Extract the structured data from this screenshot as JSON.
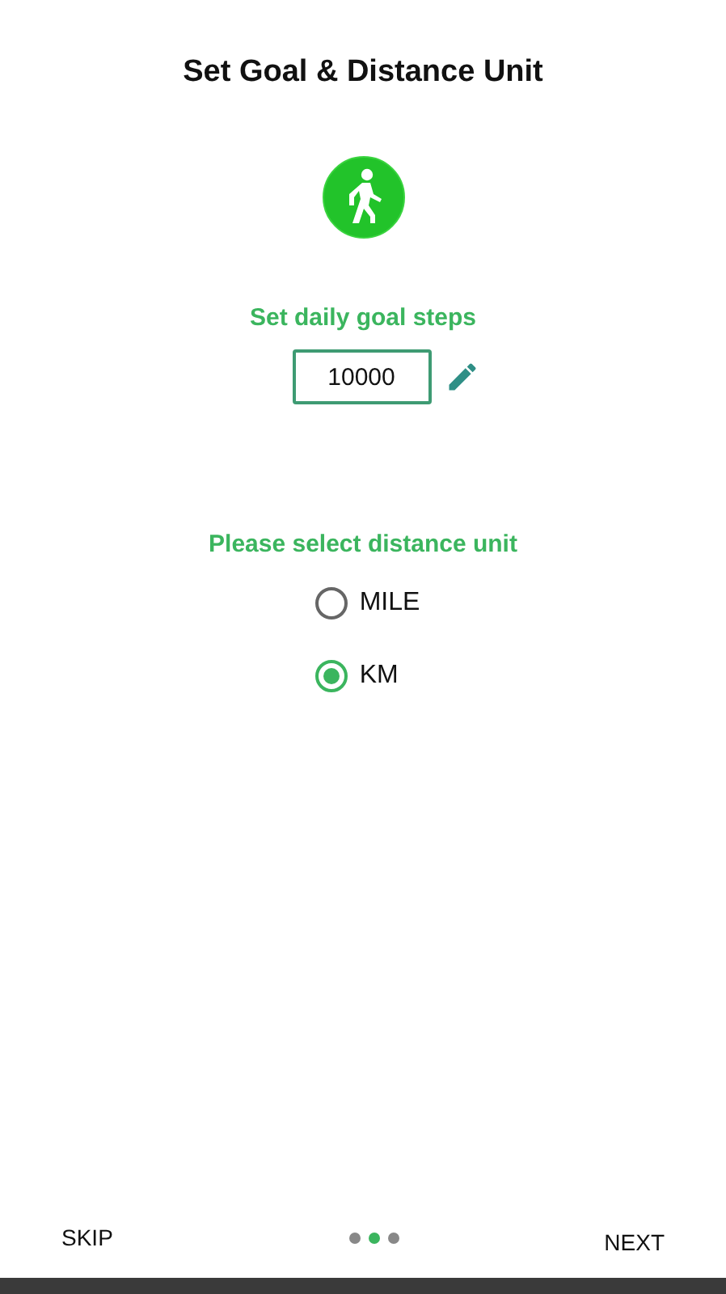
{
  "title": "Set Goal & Distance Unit",
  "goal": {
    "label": "Set daily goal steps",
    "value": "10000"
  },
  "unit": {
    "label": "Please select distance unit",
    "options": [
      {
        "label": "MILE",
        "selected": false
      },
      {
        "label": "KM",
        "selected": true
      }
    ]
  },
  "footer": {
    "skip": "SKIP",
    "next": "NEXT",
    "pages": [
      {
        "selected": false
      },
      {
        "selected": true
      },
      {
        "selected": false
      }
    ]
  }
}
